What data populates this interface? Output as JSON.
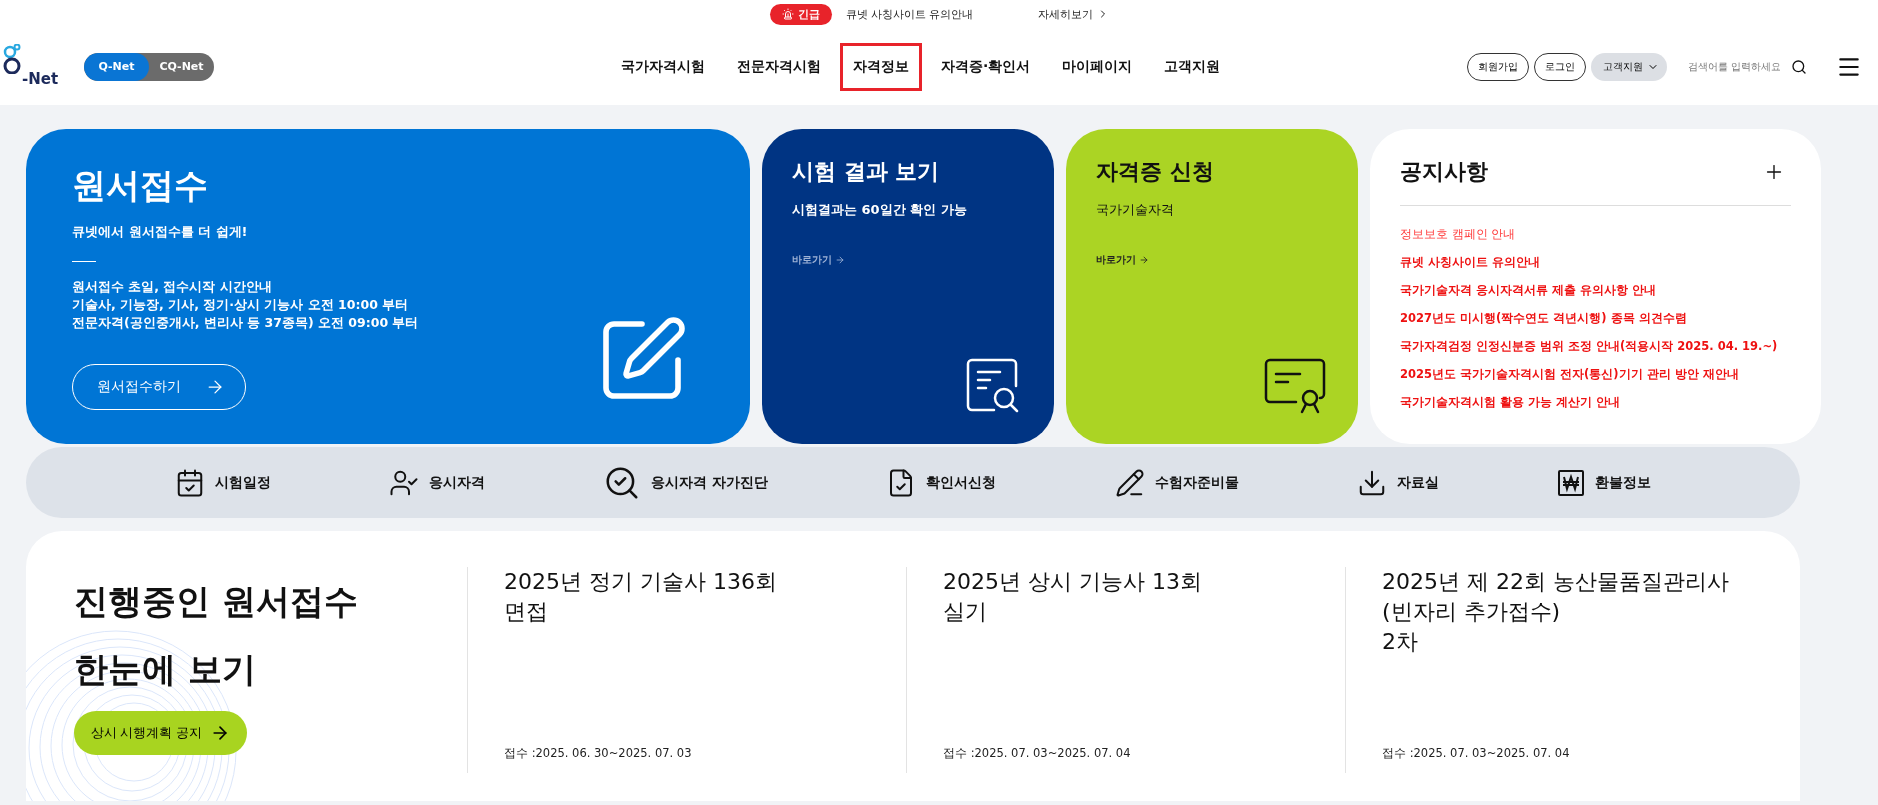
{
  "alert": {
    "badge": "긴급",
    "message": "큐넷 사칭사이트 유의안내",
    "link": "자세히보기"
  },
  "header": {
    "logo": "-Net",
    "toggle": [
      {
        "label": "Q-Net",
        "selected": true
      },
      {
        "label": "CQ-Net",
        "selected": false
      }
    ],
    "nav": [
      {
        "label": "국가자격시험",
        "selected": false
      },
      {
        "label": "전문자격시험",
        "selected": false
      },
      {
        "label": "자격정보",
        "selected": true
      },
      {
        "label": "자격증·확인서",
        "selected": false
      },
      {
        "label": "마이페이지",
        "selected": false
      },
      {
        "label": "고객지원",
        "selected": false
      }
    ],
    "buttons": [
      "회원가입",
      "로그인"
    ],
    "dropdown": "고객지원",
    "search": {
      "placeholder": "검색어를 입력하세요"
    }
  },
  "main_card": {
    "title": "원서접수",
    "subtitle": "큐넷에서 원서접수를 더 쉽게!",
    "lines": [
      "원서접수 초일, 접수시작 시간안내",
      "기술사, 기능장, 기사, 정기·상시 기능사 오전 10:00 부터",
      "전문자격(공인중개사, 변리사 등 37종목) 오전 09:00 부터"
    ],
    "button": "원서접수하기"
  },
  "cards": [
    {
      "kind": "result",
      "title": "시험 결과 보기",
      "subtitle": "시험결과는 60일간 확인 가능",
      "link": "바로가기"
    },
    {
      "kind": "certificate",
      "title": "자격증 신청",
      "subtitle": "국가기술자격",
      "link": "바로가기"
    }
  ],
  "notices": {
    "title": "공지사항",
    "items": [
      {
        "text": "정보보호 캠페인 안내",
        "bold": false
      },
      {
        "text": "큐넷 사칭사이트 유의안내",
        "bold": true
      },
      {
        "text": "국가기술자격 응시자격서류 제출 유의사항 안내",
        "bold": true
      },
      {
        "text": "2027년도 미시행(짝수연도 격년시행) 종목 의견수렴",
        "bold": true
      },
      {
        "text": "국가자격검정 인정신분증 범위 조정 안내(적용시작 2025. 04. 19.~)",
        "bold": true
      },
      {
        "text": "2025년도 국가기술자격시험 전자(통신)기기 관리 방안 재안내",
        "bold": true
      },
      {
        "text": "국가기술자격시험 활용 가능 계산기 안내",
        "bold": true
      }
    ]
  },
  "quick_menu": [
    {
      "kind": "calendar",
      "label": "시험일정"
    },
    {
      "kind": "person",
      "label": "응시자격"
    },
    {
      "kind": "search",
      "label": "응시자격 자가진단"
    },
    {
      "kind": "document",
      "label": "확인서신청"
    },
    {
      "kind": "pencil",
      "label": "수험자준비물"
    },
    {
      "kind": "download",
      "label": "자료실"
    },
    {
      "kind": "won",
      "label": "환불정보"
    }
  ],
  "ongoing": {
    "title_lines": [
      "진행중인 원서접수",
      "한눈에 보기"
    ],
    "button": "상시 시행계획 공지",
    "items": [
      {
        "title_lines": [
          "2025년 정기 기술사 136회",
          "면접"
        ],
        "period": "접수 :2025. 06. 30~2025. 07. 03"
      },
      {
        "title_lines": [
          "2025년 상시 기능사 13회",
          "실기"
        ],
        "period": "접수 :2025. 07. 03~2025. 07. 04"
      },
      {
        "title_lines": [
          "2025년 제 22회 농산물품질관리사",
          "(빈자리 추가접수)",
          "2차"
        ],
        "period": "접수 :2025. 07. 03~2025. 07. 04"
      }
    ]
  }
}
